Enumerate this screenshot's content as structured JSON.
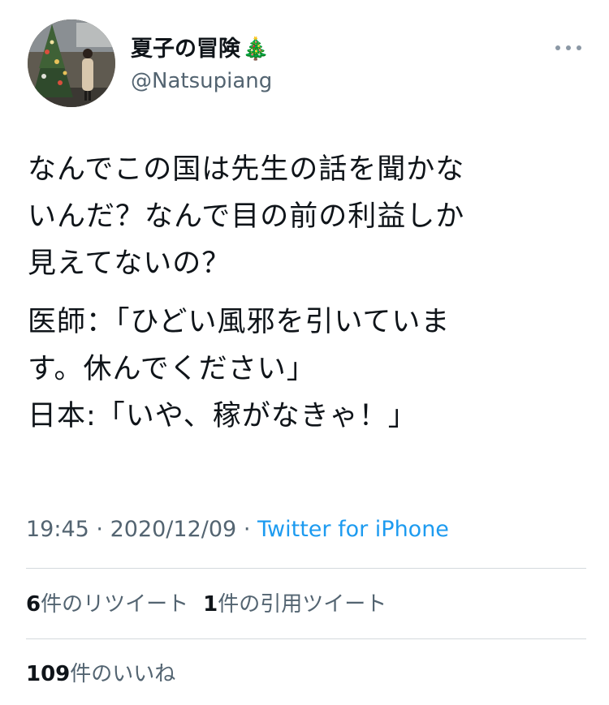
{
  "user": {
    "display_name": "夏子の冒険",
    "name_emoji": "🎄",
    "handle": "@Natsupiang"
  },
  "icons": {
    "more": "more-horizontal-icon",
    "avatar": "avatar-photo"
  },
  "tweet": {
    "lines_p1": [
      "なんでこの国は先生の話を聞かな",
      "いんだ？なんで目の前の利益しか",
      "見えてないの？"
    ],
    "lines_p2": [
      "医師：「ひどい風邪を引いていま",
      "す。休んでください」",
      "日本:「いや、稼がなきゃ！」"
    ]
  },
  "meta": {
    "time": "19:45",
    "date": "2020/12/09",
    "separator": "·",
    "source": "Twitter for iPhone"
  },
  "stats": {
    "retweets_count": "6",
    "retweets_label": "件のリツイート",
    "quotes_count": "1",
    "quotes_label": "件の引用ツイート",
    "likes_count": "109",
    "likes_label": "件のいいね"
  },
  "colors": {
    "text": "#0f1419",
    "secondary": "#536471",
    "link": "#1d9bf0",
    "divider": "#d4d9dd"
  }
}
